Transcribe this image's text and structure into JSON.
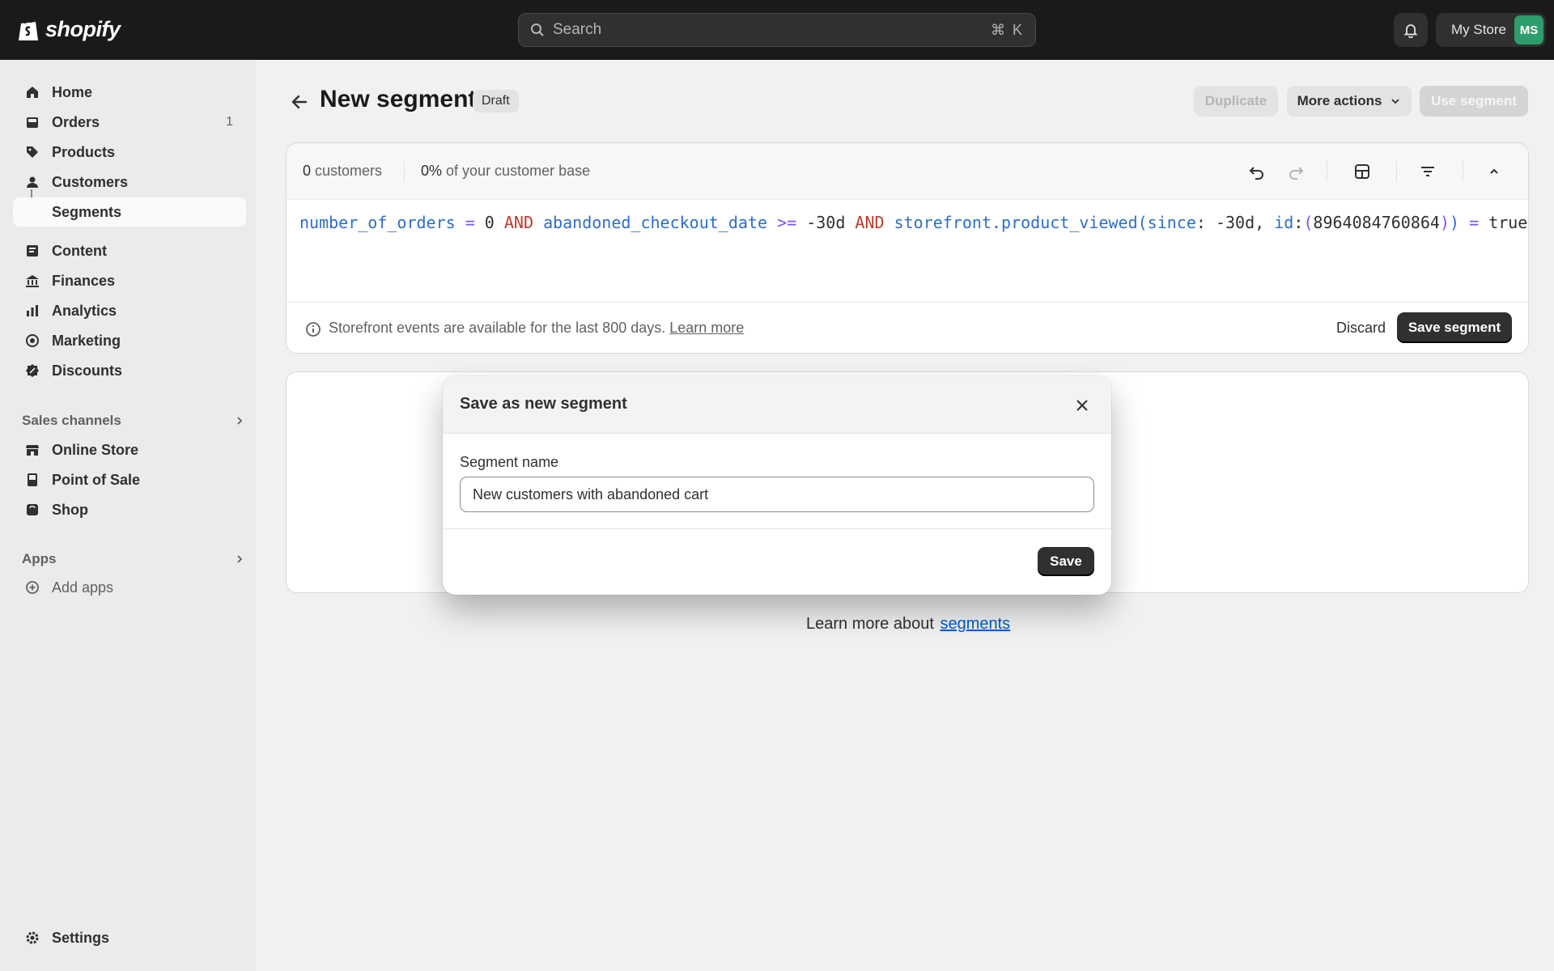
{
  "topbar": {
    "logo_text": "shopify",
    "search_placeholder": "Search",
    "search_shortcut": "⌘ K",
    "store_name": "My Store",
    "avatar_initials": "MS"
  },
  "sidebar": {
    "items": [
      {
        "label": "Home",
        "icon": "home-icon"
      },
      {
        "label": "Orders",
        "icon": "orders-icon",
        "badge": "1"
      },
      {
        "label": "Products",
        "icon": "tag-icon"
      },
      {
        "label": "Customers",
        "icon": "person-icon"
      },
      {
        "label": "Segments"
      },
      {
        "label": "Content",
        "icon": "content-icon"
      },
      {
        "label": "Finances",
        "icon": "bank-icon"
      },
      {
        "label": "Analytics",
        "icon": "chart-icon"
      },
      {
        "label": "Marketing",
        "icon": "target-icon"
      },
      {
        "label": "Discounts",
        "icon": "discount-icon"
      }
    ],
    "sales_channels_title": "Sales channels",
    "sales_channels": [
      {
        "label": "Online Store",
        "icon": "store-icon"
      },
      {
        "label": "Point of Sale",
        "icon": "pos-icon"
      },
      {
        "label": "Shop",
        "icon": "shop-icon"
      }
    ],
    "apps_title": "Apps",
    "add_apps": "Add apps",
    "settings": "Settings"
  },
  "header": {
    "title": "New segment",
    "badge": "Draft",
    "duplicate": "Duplicate",
    "more_actions": "More actions",
    "use_segment": "Use segment"
  },
  "editor": {
    "count_value": "0",
    "count_label": "customers",
    "pct_value": "0%",
    "pct_label": "of your customer base",
    "query": {
      "t1": "number_of_orders",
      "t2": "=",
      "t3": "0",
      "t4": "AND",
      "t5": "abandoned_checkout_date",
      "t6": ">=",
      "t7": "-30d",
      "t8": "AND",
      "t9": "storefront.product_viewed(",
      "t10": "since",
      "t11": ": -30d, ",
      "t12": "id",
      "t13": ":",
      "t14": "(",
      "t15": "8964084760864",
      "t16": ")",
      "t17": ")",
      "t18": "=",
      "t19": "true"
    },
    "info": "Storefront events are available for the last 800 days.",
    "info_link": "Learn more",
    "discard": "Discard",
    "save_segment": "Save segment"
  },
  "learn_more": {
    "text": "Learn more about",
    "link": "segments"
  },
  "modal": {
    "title": "Save as new segment",
    "field_label": "Segment name",
    "field_value": "New customers with abandoned cart",
    "save": "Save"
  },
  "colors": {
    "topbar": "#1a1a1a",
    "primary_button": "#303030",
    "link": "#005bd3",
    "avatar": "#2d9e6b"
  }
}
